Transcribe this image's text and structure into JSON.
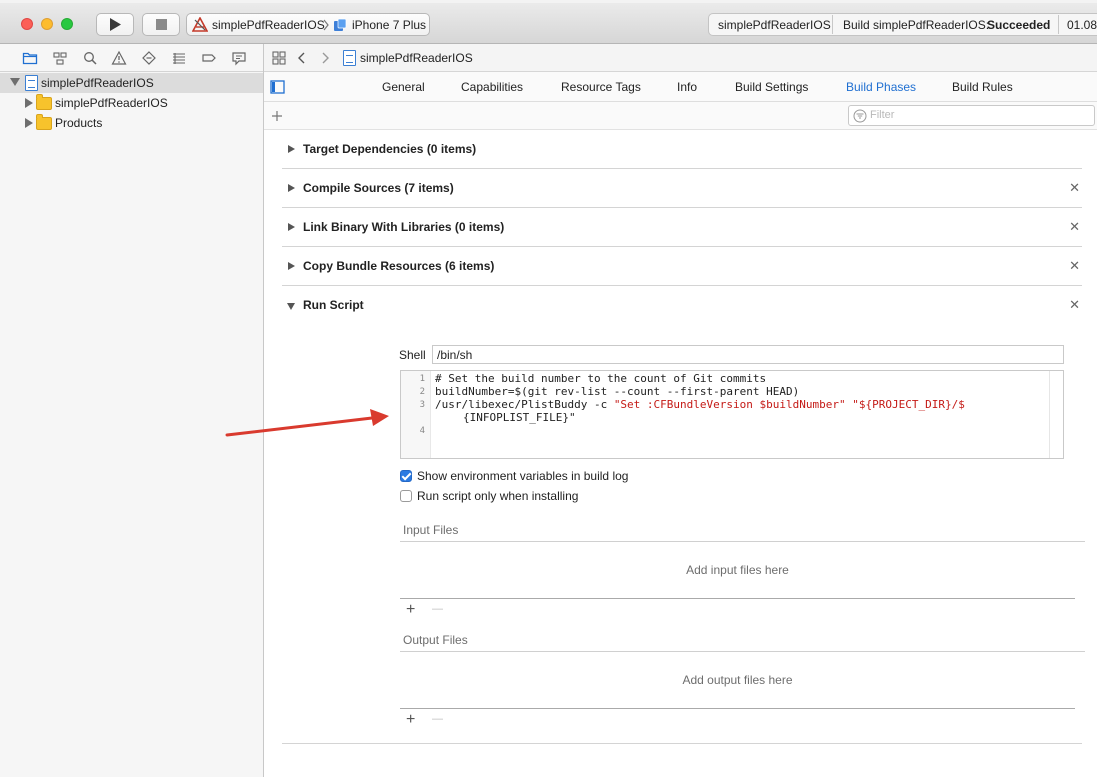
{
  "titlebar": {
    "scheme": {
      "target": "simplePdfReaderIOS",
      "device": "iPhone 7 Plus"
    },
    "activity": {
      "project": "simplePdfReaderIOS",
      "status_prefix": "Build simplePdfReaderIOS:",
      "status_result": "Succeeded",
      "time": "01.08."
    }
  },
  "navigator": {
    "items": [
      {
        "label": "simplePdfReaderIOS",
        "type": "project",
        "expanded": true,
        "selected": true
      },
      {
        "label": "simplePdfReaderIOS",
        "type": "folder",
        "expanded": false
      },
      {
        "label": "Products",
        "type": "folder",
        "expanded": false
      }
    ]
  },
  "jumpbar": {
    "breadcrumb": "simplePdfReaderIOS"
  },
  "tabs": [
    {
      "label": "General"
    },
    {
      "label": "Capabilities"
    },
    {
      "label": "Resource Tags"
    },
    {
      "label": "Info"
    },
    {
      "label": "Build Settings"
    },
    {
      "label": "Build Phases",
      "active": true
    },
    {
      "label": "Build Rules"
    }
  ],
  "filter": {
    "placeholder": "Filter"
  },
  "phases": [
    {
      "title": "Target Dependencies (0 items)",
      "expanded": false,
      "deletable": false
    },
    {
      "title": "Compile Sources (7 items)",
      "expanded": false,
      "deletable": true
    },
    {
      "title": "Link Binary With Libraries (0 items)",
      "expanded": false,
      "deletable": true
    },
    {
      "title": "Copy Bundle Resources (6 items)",
      "expanded": false,
      "deletable": true
    },
    {
      "title": "Run Script",
      "expanded": true,
      "deletable": true
    }
  ],
  "run_script": {
    "shell_label": "Shell",
    "shell_value": "/bin/sh",
    "line_numbers": [
      "1",
      "2",
      "3",
      "4"
    ],
    "code": {
      "line1_comment": "# Set the build number to the count of Git commits",
      "line2": "buildNumber=$(git rev-list --count --first-parent HEAD)",
      "line3_prefix": "/usr/libexec/PlistBuddy -c ",
      "line3_str1": "\"Set :CFBundleVersion $buildNumber\"",
      "line3_space": " ",
      "line3_str2": "\"${PROJECT_DIR}/$",
      "line3_wrap": "{INFOPLIST_FILE}\""
    },
    "show_env_label": "Show environment variables in build log",
    "show_env_checked": true,
    "run_only_label": "Run script only when installing",
    "run_only_checked": false,
    "input_files_label": "Input Files",
    "input_files_placeholder": "Add input files here",
    "output_files_label": "Output Files",
    "output_files_placeholder": "Add output files here",
    "plus": "+",
    "minus": "—"
  },
  "colors": {
    "accent": "#1f6fd1",
    "annotation_arrow": "#d93a2e",
    "comment": "#1e7f1e",
    "string": "#c41a16"
  }
}
